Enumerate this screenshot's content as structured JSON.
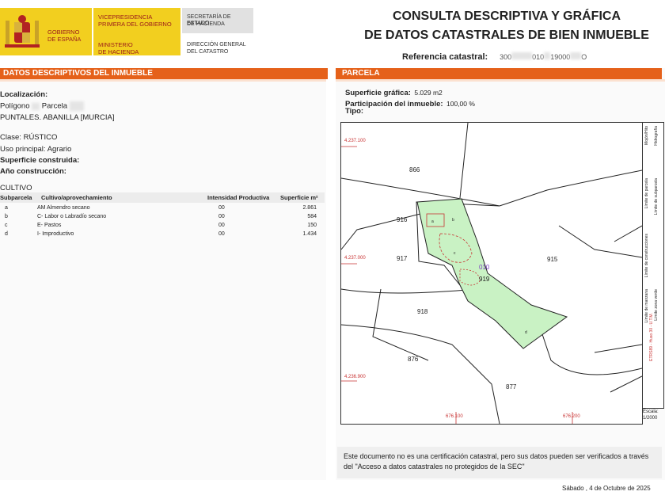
{
  "header": {
    "gov_line1": "GOBIERNO",
    "gov_line2": "DE ESPAÑA",
    "vice_line1": "VICEPRESIDENCIA",
    "vice_line2": "PRIMERA DEL GOBIERNO",
    "min_line1": "MINISTERIO",
    "min_line2": "DE HACIENDA",
    "sec_line1": "SECRETARÍA DE ESTADO",
    "sec_line2": "DE HACIENDA",
    "dir_line1": "DIRECCIÓN GENERAL",
    "dir_line2": "DEL CATASTRO"
  },
  "title": {
    "line1": "CONSULTA DESCRIPTIVA Y GRÁFICA",
    "line2": "DE DATOS CATASTRALES DE BIEN INMUEBLE",
    "ref_label": "Referencia catastral:",
    "ref_prefix": "300",
    "ref_mid": "010",
    "ref_mid2": "19000",
    "ref_suffix": "O"
  },
  "left": {
    "section_title": "DATOS DESCRIPTIVOS DEL INMUEBLE",
    "localizacion_label": "Localización:",
    "poligono_label": "Polígono",
    "parcela_label": "Parcela",
    "address": "PUNTALES. ABANILLA [MURCIA]",
    "clase_label": "Clase:",
    "clase_value": "RÚSTICO",
    "uso_label": "Uso principal:",
    "uso_value": "Agrario",
    "sup_const_label": "Superficie construida:",
    "anio_label": "Año construcción:",
    "cultivo_title": "CULTIVO",
    "cultivo_headers": [
      "Subparcela",
      "Cultivo/aprovechamiento",
      "Intensidad Productiva",
      "Superficie m²"
    ],
    "cultivo_rows": [
      [
        "a",
        "AM Almendro secano",
        "00",
        "2.861"
      ],
      [
        "b",
        "C- Labor o Labradío secano",
        "00",
        "584"
      ],
      [
        "c",
        "E- Pastos",
        "00",
        "150"
      ],
      [
        "d",
        "I- Improductivo",
        "00",
        "1.434"
      ]
    ]
  },
  "right": {
    "section_title": "PARCELA",
    "sup_grafica_label": "Superficie gráfica:",
    "sup_grafica_value": "5.029 m2",
    "participacion_label": "Participación del inmueble:",
    "participacion_value": "100,00 %",
    "tipo_label": "Tipo:"
  },
  "map": {
    "coord_y1": "4.237.100",
    "coord_y2": "4.237.000",
    "coord_y3": "4.236.900",
    "coord_x1": "676.100",
    "coord_x2": "676.200",
    "plots": [
      "866",
      "916",
      "917",
      "915",
      "919",
      "918",
      "876",
      "877",
      "010"
    ],
    "sub_labels": [
      "a",
      "b",
      "c",
      "d"
    ],
    "legend": [
      "Mojón/Hito",
      "Límite de parcela",
      "Límite de construcciones",
      "Límite de manzana",
      "Límite zona verde",
      "Hidrografía",
      "Límite de subparcela",
      "ETRS89 - Huso 30 - U.T.M."
    ],
    "scale_label": "Escala:",
    "scale_value": "1/2000",
    "parcel_color": "#c9f2c4",
    "line_color": "#222222",
    "coord_color": "#c83232"
  },
  "footer": {
    "notice": "Este documento no es una certificación catastral, pero sus datos pueden ser verificados a través del \"Acceso a datos catastrales no protegidos de la SEC\"",
    "date": "Sábado , 4 de Octubre de 2025"
  },
  "colors": {
    "accent": "#e5611a",
    "brand_yellow": "#f2cf1f"
  }
}
